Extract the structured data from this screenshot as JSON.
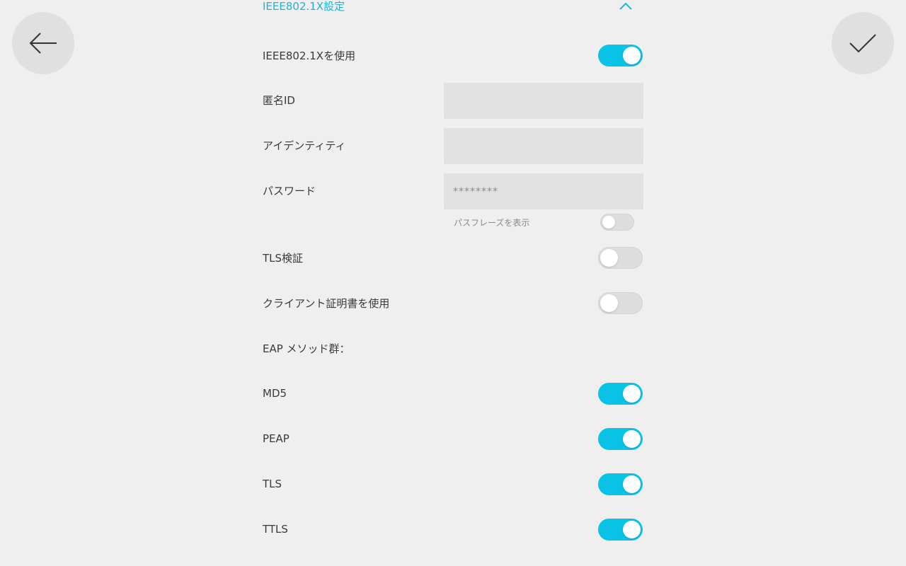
{
  "navigation": {
    "back_icon": "arrow-left-icon",
    "confirm_icon": "checkmark-icon"
  },
  "section": {
    "title": "IEEE802.1X設定",
    "chevron_icon": "chevron-up-icon"
  },
  "settings": {
    "use_8021x": {
      "label": "IEEE802.1Xを使用",
      "state": "on"
    },
    "anonymous_id": {
      "label": "匿名ID",
      "value": "",
      "placeholder": ""
    },
    "identity": {
      "label": "アイデンティティ",
      "value": "",
      "placeholder": ""
    },
    "password": {
      "label": "パスワード",
      "value": "",
      "placeholder": "********"
    },
    "show_passphrase": {
      "label": "パスフレーズを表示",
      "state": "off"
    },
    "tls_verify": {
      "label": "TLS検証",
      "state": "off"
    },
    "use_client_cert": {
      "label": "クライアント証明書を使用",
      "state": "off"
    },
    "eap_methods_heading": "EAP メソッド群：",
    "eap_methods": [
      {
        "label": "MD5",
        "state": "on"
      },
      {
        "label": "PEAP",
        "state": "on"
      },
      {
        "label": "TLS",
        "state": "on"
      },
      {
        "label": "TTLS",
        "state": "on"
      }
    ]
  },
  "colors": {
    "accent": "#09c3e6",
    "accent_text": "#1fb4d8",
    "background": "#efefef",
    "field_background": "#e1e1e1",
    "toggle_off": "#dddddd"
  }
}
